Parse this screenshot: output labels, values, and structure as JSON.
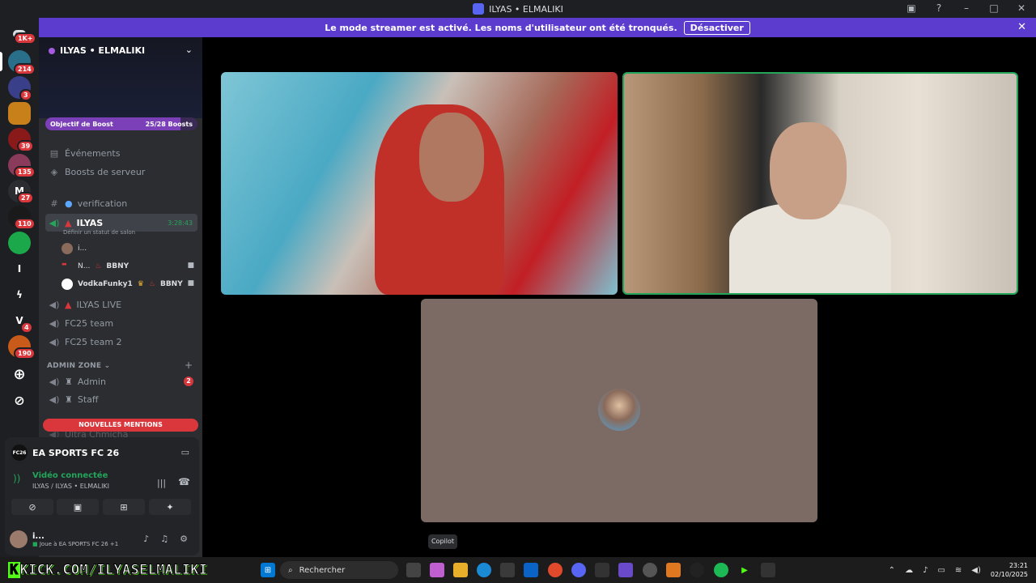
{
  "window": {
    "title": "ILYAS • ELMALIKI"
  },
  "banner": {
    "text": "Le mode streamer est activé. Les noms d'utilisateur ont été tronqués.",
    "button": "Désactiver"
  },
  "rail": {
    "badges": [
      "1K+",
      "214",
      "3",
      "39",
      "135",
      "27",
      "110",
      "4",
      "190"
    ],
    "letters": [
      "I",
      "V"
    ]
  },
  "server": {
    "name": "ILYAS • ELMALIKI",
    "boost_label": "Objectif de Boost",
    "boost_count": "25/28 Boosts",
    "boost_progress": 0.89
  },
  "channels": {
    "events": "Événements",
    "boosts": "Boosts de serveur",
    "verification": "verification",
    "voice_active": "ILYAS",
    "voice_active_time": "3:28:43",
    "voice_status": "Définir un statut de salon",
    "members": [
      {
        "name": "i...",
        "tag": ""
      },
      {
        "name": "N...",
        "tag": "BBNY"
      },
      {
        "name": "VodkaFunky1",
        "tag": "BBNY"
      }
    ],
    "live": "ILYAS LIVE",
    "team1": "FC25 team",
    "team2": "FC25 team 2",
    "admin_zone": "ADMIN ZONE",
    "admin": "Admin",
    "admin_badge": "2",
    "staff": "Staff",
    "cut_channel": "Ultra Chmicha",
    "new_mentions": "NOUVELLES MENTIONS"
  },
  "panel": {
    "game": "EA SPORTS FC 26",
    "game_logo": "FC26",
    "voice_status": "Vidéo connectée",
    "voice_channel": "ILYAS / ILYAS • ELMALIKI",
    "user_name": "i...",
    "user_activity": "Joue à EA SPORTS FC 26",
    "user_activity_extra": "+1"
  },
  "tooltip": "Copilot",
  "taskbar": {
    "kick_prefix": "K",
    "kick_text": "KICK.COM/ILYASELMALIKI",
    "search": "Rechercher",
    "time": "23:21",
    "date": "02/10/2025"
  }
}
